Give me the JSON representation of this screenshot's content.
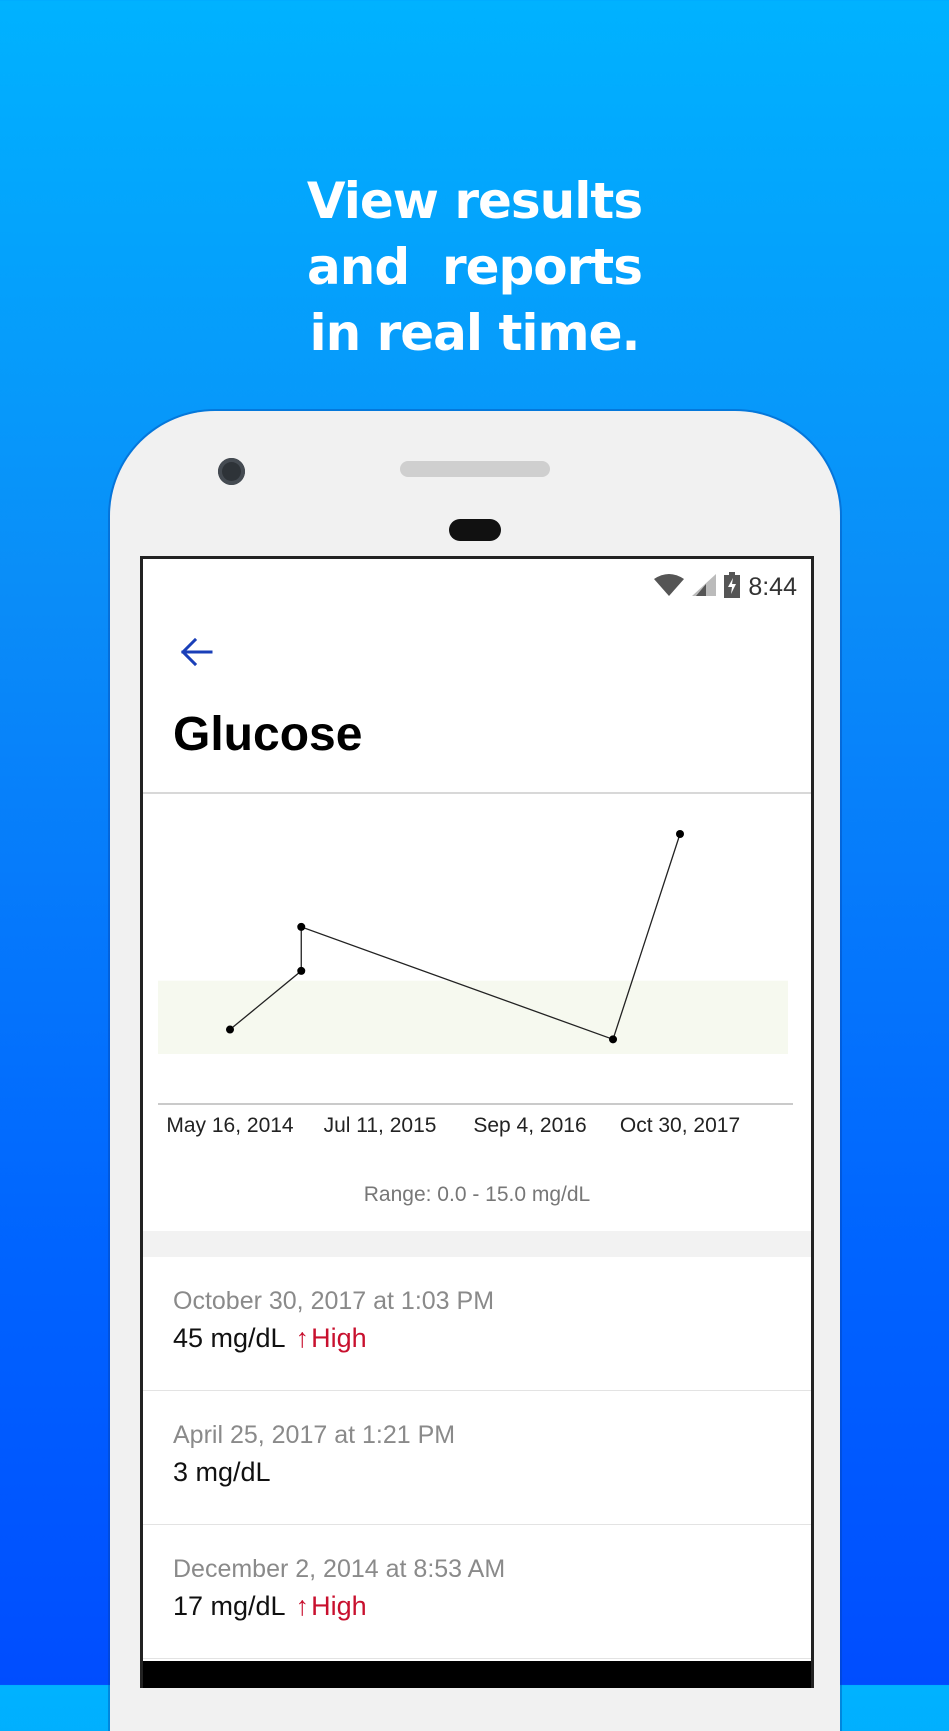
{
  "headline": {
    "line1": "View results",
    "line2": "and  reports",
    "line3": "in real time."
  },
  "status_bar": {
    "time": "8:44",
    "icons": [
      "wifi-icon",
      "cell-signal-icon",
      "battery-charging-icon"
    ]
  },
  "header": {
    "back_icon": "arrow-left-icon",
    "title": "Glucose"
  },
  "chart_data": {
    "type": "line",
    "x_tick_labels": [
      "May 16, 2014",
      "Jul 11, 2015",
      "Sep 4, 2016",
      "Oct 30, 2017"
    ],
    "series": [
      {
        "points": [
          {
            "x": "2014-05-16",
            "y": 5
          },
          {
            "x": "2014-12-02",
            "y": 17
          },
          {
            "x": "2014-12-02",
            "y": 26
          },
          {
            "x": "2017-04-25",
            "y": 3
          },
          {
            "x": "2017-10-30",
            "y": 45
          }
        ]
      }
    ],
    "reference_range": {
      "low": 0.0,
      "high": 15.0,
      "unit": "mg/dL"
    },
    "range_label": "Range: 0.0 - 15.0 mg/dL",
    "grid": false
  },
  "results": [
    {
      "date": "October 30, 2017 at 1:03 PM",
      "value": "45 mg/dL",
      "flag_arrow": "↑",
      "flag": "High"
    },
    {
      "date": "April 25, 2017 at 1:21 PM",
      "value": "3 mg/dL",
      "flag_arrow": "",
      "flag": ""
    },
    {
      "date": "December 2, 2014 at 8:53 AM",
      "value": "17 mg/dL",
      "flag_arrow": "↑",
      "flag": "High"
    }
  ],
  "colors": {
    "accent_blue": "#1a3fb8",
    "high_red": "#c8102e",
    "range_band": "#f6f9ef"
  }
}
